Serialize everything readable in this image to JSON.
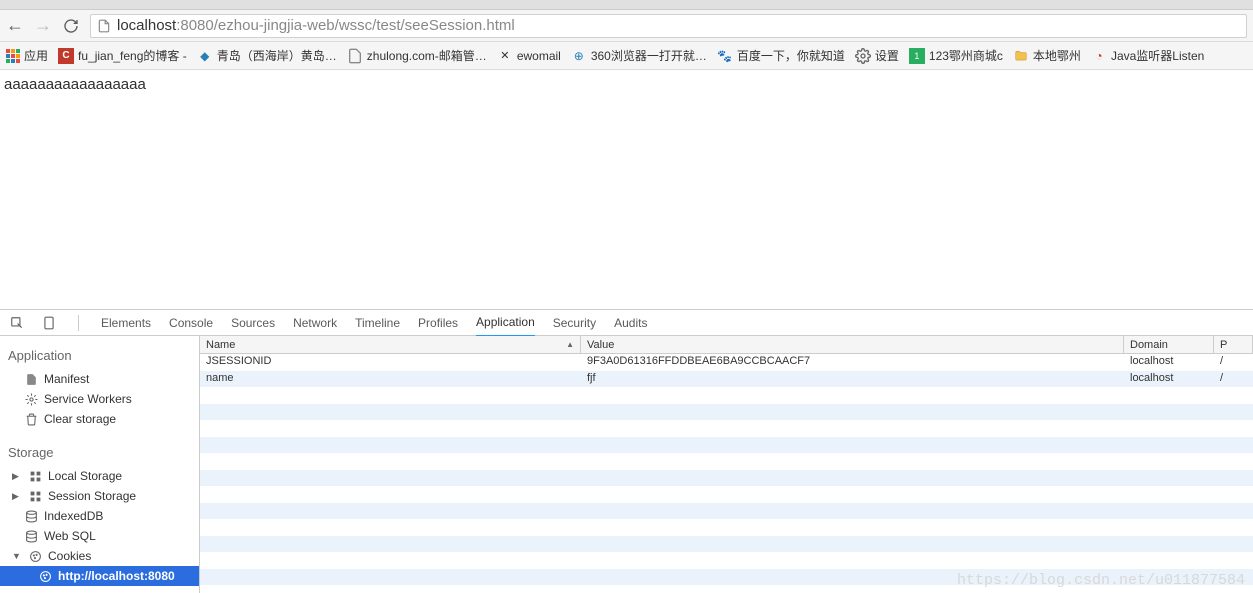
{
  "url": {
    "scheme": "",
    "host": "localhost",
    "port": ":8080",
    "path": "/ezhou-jingjia-web/wssc/test/seeSession.html"
  },
  "bookmarks": {
    "apps": "应用",
    "items": [
      "fu_jian_feng的博客 -",
      "青岛（西海岸）黄岛…",
      "zhulong.com-邮箱管…",
      "ewomail",
      "360浏览器一打开就…",
      "百度一下，你就知道",
      "设置",
      "123鄂州商城c",
      "本地鄂州",
      "Java监听器Listen"
    ]
  },
  "page": {
    "content": "aaaaaaaaaaaaaaaaa"
  },
  "devtools": {
    "tabs": [
      "Elements",
      "Console",
      "Sources",
      "Network",
      "Timeline",
      "Profiles",
      "Application",
      "Security",
      "Audits"
    ],
    "active": "Application",
    "sidebar": {
      "application": {
        "title": "Application",
        "manifest": "Manifest",
        "sw": "Service Workers",
        "clear": "Clear storage"
      },
      "storage": {
        "title": "Storage",
        "local": "Local Storage",
        "session": "Session Storage",
        "idb": "IndexedDB",
        "websql": "Web SQL",
        "cookies": "Cookies",
        "cookies_child": "http://localhost:8080"
      }
    },
    "table": {
      "headers": {
        "name": "Name",
        "value": "Value",
        "domain": "Domain",
        "p": "P"
      },
      "rows": [
        {
          "name": "JSESSIONID",
          "value": "9F3A0D61316FFDDBEAE6BA9CCBCAACF7",
          "domain": "localhost",
          "p": "/"
        },
        {
          "name": "name",
          "value": "fjf",
          "domain": "localhost",
          "p": "/"
        }
      ]
    }
  },
  "watermark": "https://blog.csdn.net/u011877584"
}
